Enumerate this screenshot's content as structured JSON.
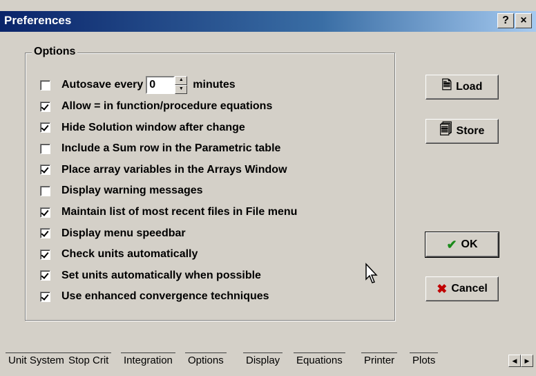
{
  "window": {
    "title": "Preferences",
    "help_label": "?",
    "close_label": "×"
  },
  "options": {
    "group_label": "Options",
    "autosave": {
      "label_before": "Autosave every",
      "value": "0",
      "label_after": "minutes",
      "checked": false
    },
    "items": [
      {
        "label": "Allow = in function/procedure equations",
        "checked": true
      },
      {
        "label": "Hide Solution window after change",
        "checked": true
      },
      {
        "label": "Include a Sum row in the Parametric table",
        "checked": false
      },
      {
        "label": "Place array variables in the Arrays Window",
        "checked": true
      },
      {
        "label": "Display warning messages",
        "checked": false
      },
      {
        "label": "Maintain list of most recent files in File menu",
        "checked": true
      },
      {
        "label": "Display menu speedbar",
        "checked": true
      },
      {
        "label": "Check units automatically",
        "checked": true
      },
      {
        "label": "Set units automatically when possible",
        "checked": true
      },
      {
        "label": "Use enhanced convergence techniques",
        "checked": true
      }
    ]
  },
  "buttons": {
    "load": "Load",
    "store": "Store",
    "ok": "OK",
    "cancel": "Cancel"
  },
  "tabs": [
    "Unit System",
    "Stop Crit",
    "Integration",
    "Options",
    "Display",
    "Equations",
    "Printer",
    "Plots"
  ],
  "active_tab": "Options"
}
